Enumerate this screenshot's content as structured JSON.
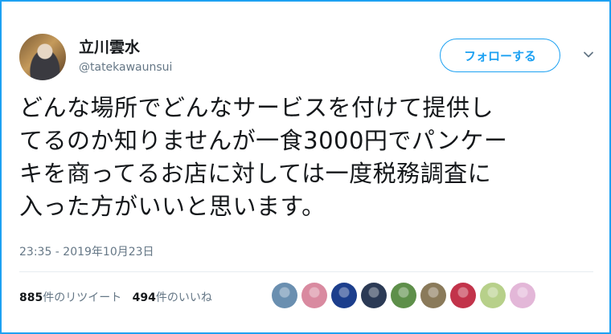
{
  "user": {
    "name": "立川雲水",
    "handle": "@tatekawaunsui"
  },
  "follow_button": "フォローする",
  "tweet": {
    "lines": [
      "どんな場所でどんなサービスを付けて提供し",
      "てるのか知りませんが一食3000円でパンケー",
      "キを商ってるお店に対しては一度税務調査に",
      "入った方がいいと思います。"
    ],
    "timestamp": "23:35 - 2019年10月23日"
  },
  "stats": {
    "retweet_count": "885",
    "retweet_label": "件のリツイート",
    "like_count": "494",
    "like_label": "件のいいね"
  },
  "liker_avatars": [
    {
      "name": "liker-avatar-1",
      "color": "#6a8fb0"
    },
    {
      "name": "liker-avatar-2",
      "color": "#d98aa0"
    },
    {
      "name": "liker-avatar-3",
      "color": "#1c3e8c"
    },
    {
      "name": "liker-avatar-4",
      "color": "#2b3a55"
    },
    {
      "name": "liker-avatar-5",
      "color": "#5e8f4a"
    },
    {
      "name": "liker-avatar-6",
      "color": "#8a7a5a"
    },
    {
      "name": "liker-avatar-7",
      "color": "#c2334a"
    },
    {
      "name": "liker-avatar-8",
      "color": "#b7d08a"
    },
    {
      "name": "liker-avatar-9",
      "color": "#e3b7d8"
    }
  ],
  "colors": {
    "accent": "#1da1f2",
    "secondary_text": "#657786"
  }
}
